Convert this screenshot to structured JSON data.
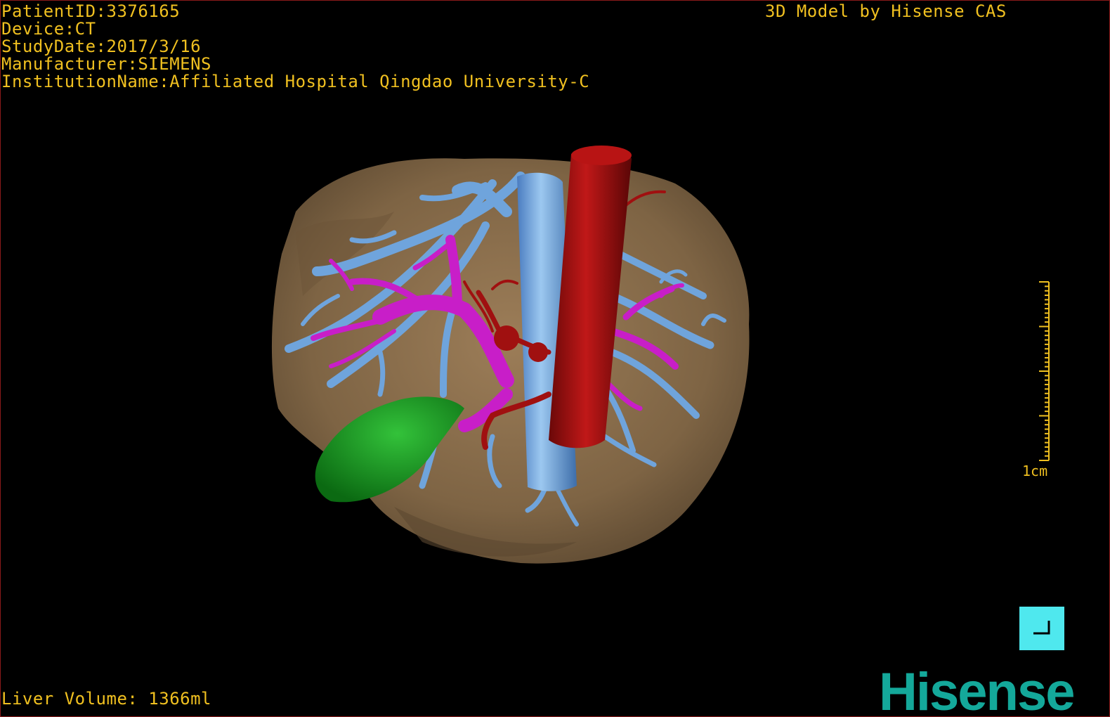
{
  "patient": {
    "id_line": "PatientID:3376165",
    "device_line": "Device:CT",
    "study_date_line": "StudyDate:2017/3/16",
    "manufacturer_line": "Manufacturer:SIEMENS",
    "institution_line": "InstitutionName:Affiliated Hospital Qingdao University-C"
  },
  "brand_text": "3D Model by Hisense CAS",
  "liver_volume": "Liver Volume: 1366ml",
  "scale": {
    "label": "1cm"
  },
  "logo": "Hisense",
  "colors": {
    "osd_text": "#f0c020",
    "liver": "#8c7150",
    "hepatic_veins": "#6fa4dc",
    "portal_vein": "#c81ec8",
    "aorta": "#a01010",
    "gallbladder": "#1a9a20",
    "button": "#4fe8ee",
    "logo": "#14a89a"
  }
}
